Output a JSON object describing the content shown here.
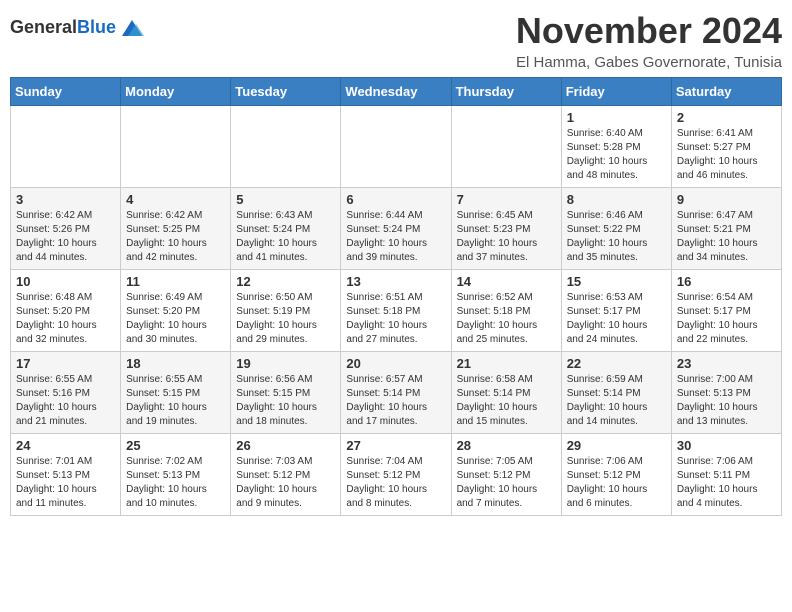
{
  "logo": {
    "general": "General",
    "blue": "Blue"
  },
  "title": "November 2024",
  "location": "El Hamma, Gabes Governorate, Tunisia",
  "days_of_week": [
    "Sunday",
    "Monday",
    "Tuesday",
    "Wednesday",
    "Thursday",
    "Friday",
    "Saturday"
  ],
  "weeks": [
    [
      {
        "day": "",
        "info": ""
      },
      {
        "day": "",
        "info": ""
      },
      {
        "day": "",
        "info": ""
      },
      {
        "day": "",
        "info": ""
      },
      {
        "day": "",
        "info": ""
      },
      {
        "day": "1",
        "info": "Sunrise: 6:40 AM\nSunset: 5:28 PM\nDaylight: 10 hours and 48 minutes."
      },
      {
        "day": "2",
        "info": "Sunrise: 6:41 AM\nSunset: 5:27 PM\nDaylight: 10 hours and 46 minutes."
      }
    ],
    [
      {
        "day": "3",
        "info": "Sunrise: 6:42 AM\nSunset: 5:26 PM\nDaylight: 10 hours and 44 minutes."
      },
      {
        "day": "4",
        "info": "Sunrise: 6:42 AM\nSunset: 5:25 PM\nDaylight: 10 hours and 42 minutes."
      },
      {
        "day": "5",
        "info": "Sunrise: 6:43 AM\nSunset: 5:24 PM\nDaylight: 10 hours and 41 minutes."
      },
      {
        "day": "6",
        "info": "Sunrise: 6:44 AM\nSunset: 5:24 PM\nDaylight: 10 hours and 39 minutes."
      },
      {
        "day": "7",
        "info": "Sunrise: 6:45 AM\nSunset: 5:23 PM\nDaylight: 10 hours and 37 minutes."
      },
      {
        "day": "8",
        "info": "Sunrise: 6:46 AM\nSunset: 5:22 PM\nDaylight: 10 hours and 35 minutes."
      },
      {
        "day": "9",
        "info": "Sunrise: 6:47 AM\nSunset: 5:21 PM\nDaylight: 10 hours and 34 minutes."
      }
    ],
    [
      {
        "day": "10",
        "info": "Sunrise: 6:48 AM\nSunset: 5:20 PM\nDaylight: 10 hours and 32 minutes."
      },
      {
        "day": "11",
        "info": "Sunrise: 6:49 AM\nSunset: 5:20 PM\nDaylight: 10 hours and 30 minutes."
      },
      {
        "day": "12",
        "info": "Sunrise: 6:50 AM\nSunset: 5:19 PM\nDaylight: 10 hours and 29 minutes."
      },
      {
        "day": "13",
        "info": "Sunrise: 6:51 AM\nSunset: 5:18 PM\nDaylight: 10 hours and 27 minutes."
      },
      {
        "day": "14",
        "info": "Sunrise: 6:52 AM\nSunset: 5:18 PM\nDaylight: 10 hours and 25 minutes."
      },
      {
        "day": "15",
        "info": "Sunrise: 6:53 AM\nSunset: 5:17 PM\nDaylight: 10 hours and 24 minutes."
      },
      {
        "day": "16",
        "info": "Sunrise: 6:54 AM\nSunset: 5:17 PM\nDaylight: 10 hours and 22 minutes."
      }
    ],
    [
      {
        "day": "17",
        "info": "Sunrise: 6:55 AM\nSunset: 5:16 PM\nDaylight: 10 hours and 21 minutes."
      },
      {
        "day": "18",
        "info": "Sunrise: 6:55 AM\nSunset: 5:15 PM\nDaylight: 10 hours and 19 minutes."
      },
      {
        "day": "19",
        "info": "Sunrise: 6:56 AM\nSunset: 5:15 PM\nDaylight: 10 hours and 18 minutes."
      },
      {
        "day": "20",
        "info": "Sunrise: 6:57 AM\nSunset: 5:14 PM\nDaylight: 10 hours and 17 minutes."
      },
      {
        "day": "21",
        "info": "Sunrise: 6:58 AM\nSunset: 5:14 PM\nDaylight: 10 hours and 15 minutes."
      },
      {
        "day": "22",
        "info": "Sunrise: 6:59 AM\nSunset: 5:14 PM\nDaylight: 10 hours and 14 minutes."
      },
      {
        "day": "23",
        "info": "Sunrise: 7:00 AM\nSunset: 5:13 PM\nDaylight: 10 hours and 13 minutes."
      }
    ],
    [
      {
        "day": "24",
        "info": "Sunrise: 7:01 AM\nSunset: 5:13 PM\nDaylight: 10 hours and 11 minutes."
      },
      {
        "day": "25",
        "info": "Sunrise: 7:02 AM\nSunset: 5:13 PM\nDaylight: 10 hours and 10 minutes."
      },
      {
        "day": "26",
        "info": "Sunrise: 7:03 AM\nSunset: 5:12 PM\nDaylight: 10 hours and 9 minutes."
      },
      {
        "day": "27",
        "info": "Sunrise: 7:04 AM\nSunset: 5:12 PM\nDaylight: 10 hours and 8 minutes."
      },
      {
        "day": "28",
        "info": "Sunrise: 7:05 AM\nSunset: 5:12 PM\nDaylight: 10 hours and 7 minutes."
      },
      {
        "day": "29",
        "info": "Sunrise: 7:06 AM\nSunset: 5:12 PM\nDaylight: 10 hours and 6 minutes."
      },
      {
        "day": "30",
        "info": "Sunrise: 7:06 AM\nSunset: 5:11 PM\nDaylight: 10 hours and 4 minutes."
      }
    ]
  ]
}
